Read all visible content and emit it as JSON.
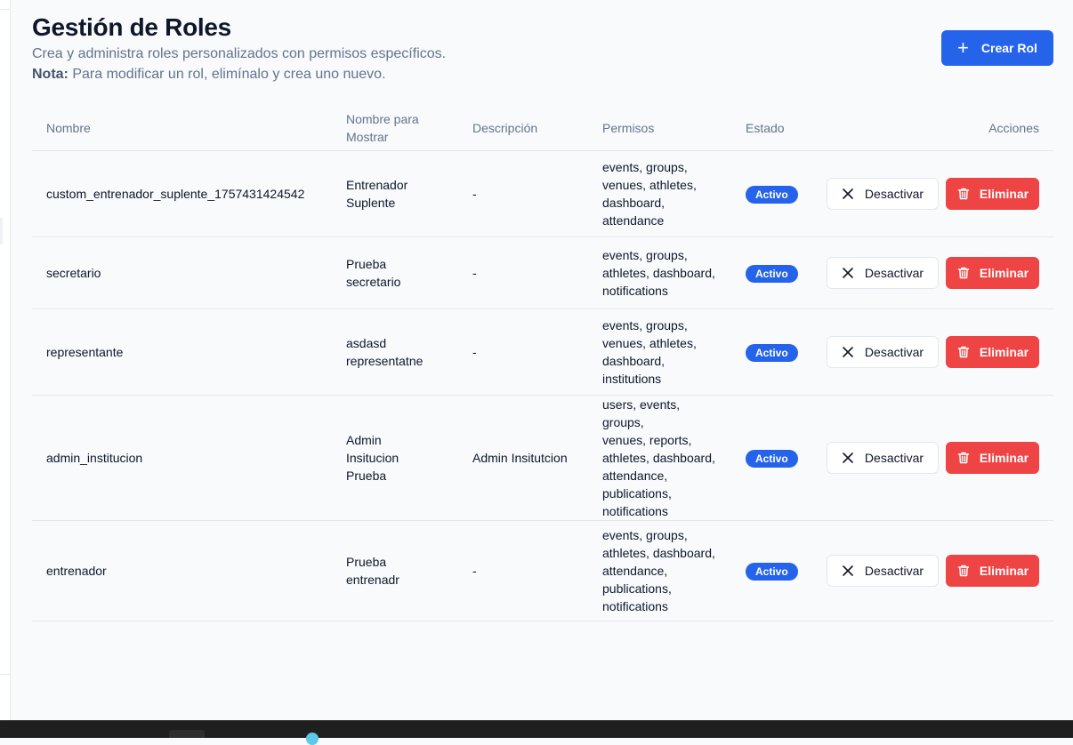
{
  "header": {
    "title": "Gestión de Roles",
    "subtitle": "Crea y administra roles personalizados con permisos específicos.",
    "note_label": "Nota:",
    "note_text": " Para modificar un rol, elimínalo y crea uno nuevo."
  },
  "create_button": {
    "label": "Crear Rol",
    "icon": "plus-icon"
  },
  "table": {
    "columns": [
      "Nombre",
      "Nombre para Mostrar",
      "Descripción",
      "Permisos",
      "Estado",
      "Acciones"
    ],
    "rows": [
      {
        "name": "custom_entrenador_suplente_1757431424542",
        "display_name": "Entrenador Suplente",
        "description": "-",
        "permissions": [
          "events, groups,",
          "venues, athletes,",
          "dashboard,",
          "attendance"
        ],
        "status": "Activo"
      },
      {
        "name": "secretario",
        "display_name": "Prueba secretario",
        "description": "-",
        "permissions": [
          "events, groups,",
          "athletes, dashboard,",
          "notifications"
        ],
        "status": "Activo"
      },
      {
        "name": "representante",
        "display_name": "asdasd representatne",
        "description": "-",
        "permissions": [
          "events, groups,",
          "venues, athletes,",
          "dashboard,",
          "institutions"
        ],
        "status": "Activo"
      },
      {
        "name": "admin_institucion",
        "display_name": "Admin Insitucion Prueba",
        "description": "Admin Insitutcion",
        "permissions": [
          "users, events, groups,",
          "venues, reports,",
          "athletes, dashboard,",
          "attendance,",
          "publications,",
          "notifications"
        ],
        "status": "Activo"
      },
      {
        "name": "entrenador",
        "display_name": "Prueba entrenadr",
        "description": "-",
        "permissions": [
          "events, groups,",
          "athletes, dashboard,",
          "attendance,",
          "publications,",
          "notifications"
        ],
        "status": "Activo"
      }
    ],
    "actions": {
      "deactivate": "Desactivar",
      "delete": "Eliminar"
    }
  },
  "colors": {
    "primary": "#2563eb",
    "danger": "#ef4444",
    "muted_text": "#64748b"
  }
}
